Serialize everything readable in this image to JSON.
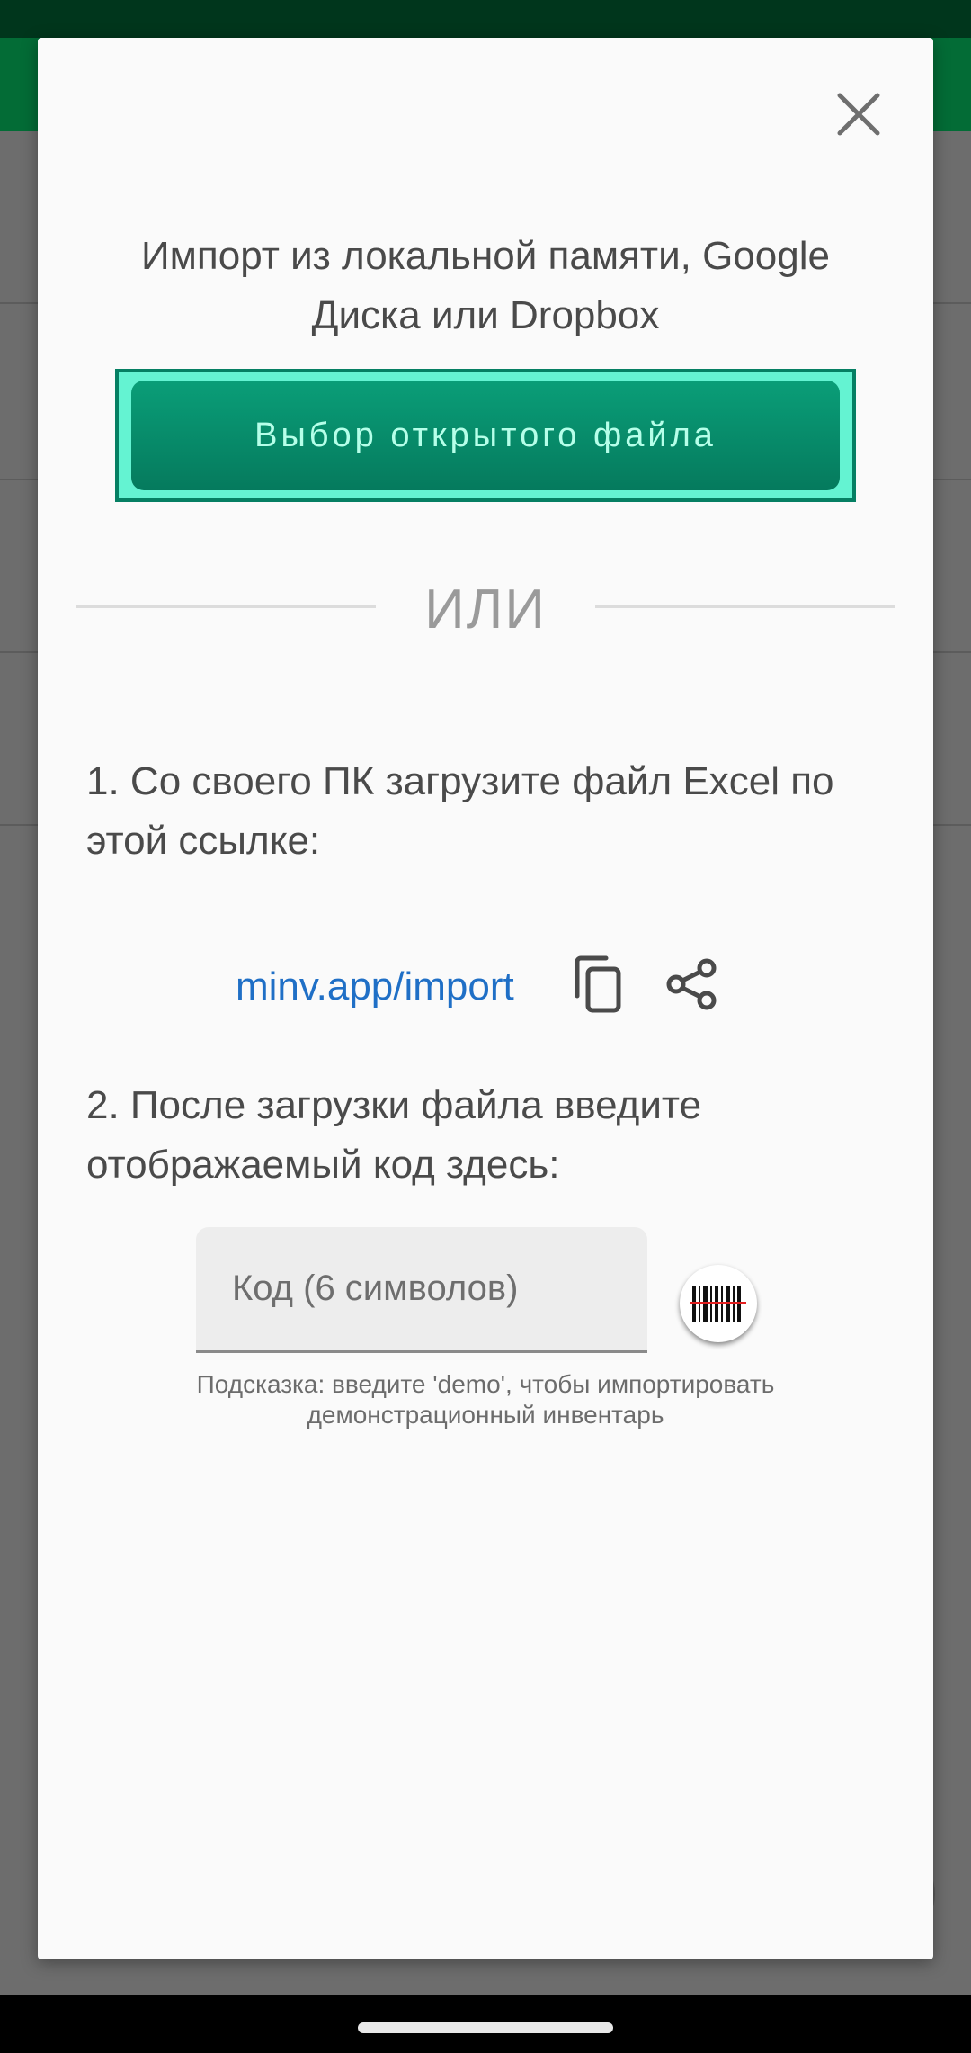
{
  "dialog": {
    "title": "Импорт из локальной памяти, Google Диска или Dropbox",
    "choose_file_button": "Выбор открытого файла",
    "or_label": "ИЛИ",
    "step1_text": "1. Со своего ПК загрузите файл Excel по этой ссылке:",
    "link_text": "minv.app/import",
    "step2_text": "2. После загрузки файла введите отображаемый код здесь:",
    "code_input": {
      "placeholder": "Код (6 символов)",
      "value": ""
    },
    "hint": "Подсказка: введите 'demo', чтобы импортировать демонстрационный инвентарь"
  },
  "icons": {
    "close": "close-icon",
    "copy": "copy-icon",
    "share": "share-icon",
    "scan": "barcode-scan-icon"
  },
  "colors": {
    "button_bg": "#057a5d",
    "button_text": "#b6ffe9",
    "button_border": "#64f3d2",
    "link": "#1f6fc6",
    "appbar": "#036c36"
  }
}
